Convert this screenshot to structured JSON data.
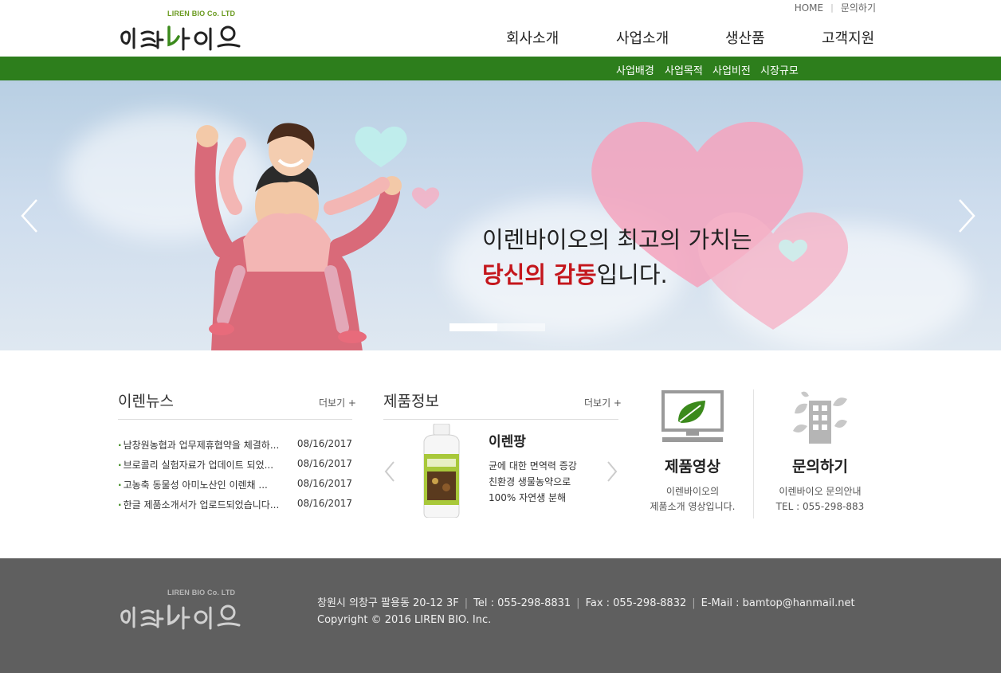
{
  "util_nav": {
    "home": "HOME",
    "inquiry": "문의하기"
  },
  "logo": {
    "company_en": "LIREN BIO Co. LTD",
    "name_ko": "이렌바이오"
  },
  "gnb": [
    "회사소개",
    "사업소개",
    "생산품",
    "고객지원"
  ],
  "subnav": [
    "사업배경",
    "사업목적",
    "사업비전",
    "시장규모"
  ],
  "hero": {
    "line1": "이렌바이오의 최고의 가치는",
    "line2_highlight": "당신의 감동",
    "line2_rest": "입니다.",
    "slide_count": 2,
    "active_slide": 1,
    "colors": {
      "highlight": "#c4161c"
    }
  },
  "news": {
    "title": "이렌뉴스",
    "more": "더보기 +",
    "items": [
      {
        "title": "남창원농협과 업무제휴협약을 체결하...",
        "date": "08/16/2017"
      },
      {
        "title": "브로콜리 실험자료가 업데이트 되었...",
        "date": "08/16/2017"
      },
      {
        "title": "고농축 동물성 아미노산인 이렌채 ...",
        "date": "08/16/2017"
      },
      {
        "title": "한글 제품소개서가 업로드되었습니다...",
        "date": "08/16/2017"
      }
    ]
  },
  "product": {
    "title": "제품정보",
    "more": "더보기 +",
    "name": "이렌팡",
    "desc": [
      "균에 대한 면역력 증강",
      "친환경 생물농약으로",
      "100% 자연생 분해"
    ]
  },
  "video_box": {
    "title": "제품영상",
    "desc": [
      "이렌바이오의",
      "제품소개 영상입니다."
    ]
  },
  "inquiry_box": {
    "title": "문의하기",
    "desc": [
      "이렌바이오 문의안내",
      "TEL : 055-298-883"
    ]
  },
  "footer": {
    "address": "창원시 의창구 팔용동 20-12 3F",
    "tel": "Tel : 055-298-8831",
    "fax": "Fax : 055-298-8832",
    "email": "E-Mail : bamtop@hanmail.net",
    "copyright": "Copyright © 2016 LIREN BIO. Inc."
  },
  "colors": {
    "brand_green": "#2d7e1c",
    "footer_bg": "#5f5f5f"
  }
}
